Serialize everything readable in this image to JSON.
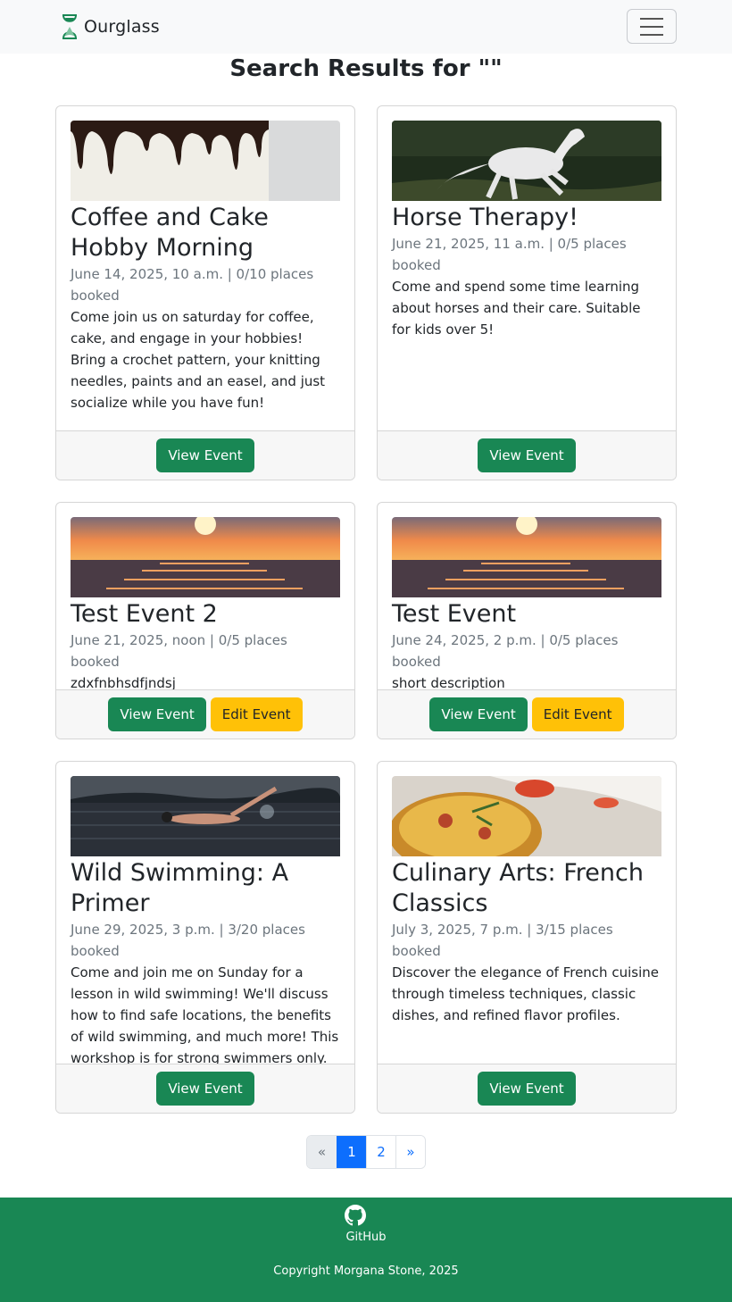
{
  "header": {
    "brand": "Ourglass"
  },
  "page_title": "Search Results for \"\"",
  "events": [
    {
      "title": "Coffee and Cake Hobby Morning",
      "meta": "June 14, 2025, 10 a.m. | 0/10 places booked",
      "description": "Come join us on saturday for coffee, cake, and engage in your hobbies! Bring a crochet pattern, your knitting needles, paints and an easel, and just socialize while you have fun!",
      "image_icon": "cake-drip-image",
      "view_label": "View Event"
    },
    {
      "title": "Horse Therapy!",
      "meta": "June 21, 2025, 11 a.m. | 0/5 places booked",
      "description": "Come and spend some time learning about horses and their care. Suitable for kids over 5!",
      "image_icon": "white-horse-image",
      "view_label": "View Event"
    },
    {
      "title": "Test Event 2",
      "meta": "June 21, 2025, noon | 0/5 places booked",
      "description": "zdxfnbhsdfjndsj",
      "image_icon": "sunset-sea-image",
      "view_label": "View Event",
      "edit_label": "Edit Event"
    },
    {
      "title": "Test Event",
      "meta": "June 24, 2025, 2 p.m. | 0/5 places booked",
      "description": "short description",
      "image_icon": "sunset-sea-image",
      "view_label": "View Event",
      "edit_label": "Edit Event"
    },
    {
      "title": "Wild Swimming: A Primer",
      "meta": "June 29, 2025, 3 p.m. | 3/20 places booked",
      "description": "Come and join me on Sunday for a lesson in wild swimming! We'll discuss how to find safe locations, the benefits of wild swimming, and much more! This workshop is for strong swimmers only.",
      "image_icon": "swimmer-lake-image",
      "view_label": "View Event"
    },
    {
      "title": "Culinary Arts: French Classics",
      "meta": "July 3, 2025, 7 p.m. | 3/15 places booked",
      "description": "Discover the elegance of French cuisine through timeless techniques, classic dishes, and refined flavor profiles.",
      "image_icon": "quiche-image",
      "view_label": "View Event"
    }
  ],
  "pagination": {
    "prev": "«",
    "pages": [
      "1",
      "2"
    ],
    "active_page": "1",
    "next": "»"
  },
  "footer": {
    "github_label": "GitHub",
    "copyright": "Copyright Morgana Stone, 2025"
  },
  "colors": {
    "primary_green": "#198754",
    "edit_yellow": "#ffc107",
    "active_blue": "#0d6efd"
  }
}
